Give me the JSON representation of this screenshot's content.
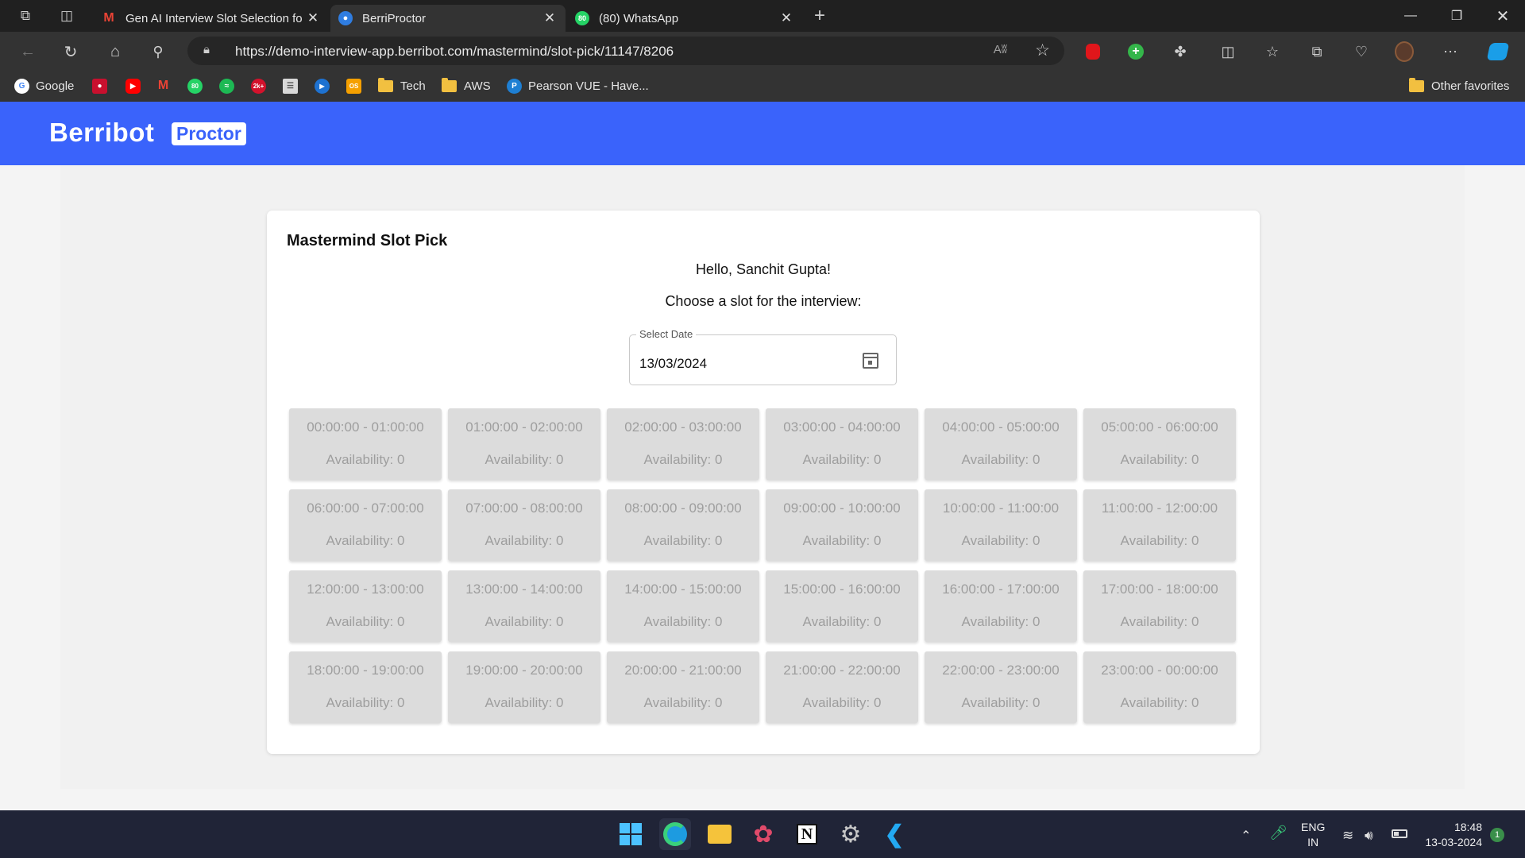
{
  "browser": {
    "tabs": [
      {
        "title": "Gen AI Interview Slot Selection fo",
        "favicon": "gmail-icon",
        "active": false
      },
      {
        "title": "BerriProctor",
        "favicon": "globe-icon",
        "active": true
      },
      {
        "title": "(80) WhatsApp",
        "favicon": "whatsapp-icon",
        "active": false
      }
    ],
    "new_tab_symbol": "+",
    "url": "https://demo-interview-app.berribot.com/mastermind/slot-pick/11147/8206",
    "read_aloud_symbol": "Aʬ",
    "bookmarks": {
      "google": "Google",
      "tech": "Tech",
      "aws": "AWS",
      "pearson": "Pearson VUE - Have...",
      "other": "Other favorites"
    },
    "badges": {
      "whatsapp": "80",
      "twok": "2k+",
      "os": "OS"
    }
  },
  "app": {
    "logo_text": "Berribot",
    "logo_tag": "Proctor",
    "page_title": "Mastermind Slot Pick",
    "greeting": "Hello, Sanchit Gupta!",
    "instruction": "Choose a slot for the interview:",
    "date_field": {
      "label": "Select Date",
      "value": "13/03/2024"
    },
    "slots": [
      {
        "time": "00:00:00 - 01:00:00",
        "availability": "Availability: 0"
      },
      {
        "time": "01:00:00 - 02:00:00",
        "availability": "Availability: 0"
      },
      {
        "time": "02:00:00 - 03:00:00",
        "availability": "Availability: 0"
      },
      {
        "time": "03:00:00 - 04:00:00",
        "availability": "Availability: 0"
      },
      {
        "time": "04:00:00 - 05:00:00",
        "availability": "Availability: 0"
      },
      {
        "time": "05:00:00 - 06:00:00",
        "availability": "Availability: 0"
      },
      {
        "time": "06:00:00 - 07:00:00",
        "availability": "Availability: 0"
      },
      {
        "time": "07:00:00 - 08:00:00",
        "availability": "Availability: 0"
      },
      {
        "time": "08:00:00 - 09:00:00",
        "availability": "Availability: 0"
      },
      {
        "time": "09:00:00 - 10:00:00",
        "availability": "Availability: 0"
      },
      {
        "time": "10:00:00 - 11:00:00",
        "availability": "Availability: 0"
      },
      {
        "time": "11:00:00 - 12:00:00",
        "availability": "Availability: 0"
      },
      {
        "time": "12:00:00 - 13:00:00",
        "availability": "Availability: 0"
      },
      {
        "time": "13:00:00 - 14:00:00",
        "availability": "Availability: 0"
      },
      {
        "time": "14:00:00 - 15:00:00",
        "availability": "Availability: 0"
      },
      {
        "time": "15:00:00 - 16:00:00",
        "availability": "Availability: 0"
      },
      {
        "time": "16:00:00 - 17:00:00",
        "availability": "Availability: 0"
      },
      {
        "time": "17:00:00 - 18:00:00",
        "availability": "Availability: 0"
      },
      {
        "time": "18:00:00 - 19:00:00",
        "availability": "Availability: 0"
      },
      {
        "time": "19:00:00 - 20:00:00",
        "availability": "Availability: 0"
      },
      {
        "time": "20:00:00 - 21:00:00",
        "availability": "Availability: 0"
      },
      {
        "time": "21:00:00 - 22:00:00",
        "availability": "Availability: 0"
      },
      {
        "time": "22:00:00 - 23:00:00",
        "availability": "Availability: 0"
      },
      {
        "time": "23:00:00 - 00:00:00",
        "availability": "Availability: 0"
      }
    ]
  },
  "taskbar": {
    "language_line1": "ENG",
    "language_line2": "IN",
    "time": "18:48",
    "date": "13-03-2024",
    "notification_count": "1"
  },
  "colors": {
    "brand_blue": "#3a63fb",
    "slot_disabled_bg": "#dcdcdc",
    "slot_disabled_text": "#9e9e9e"
  }
}
